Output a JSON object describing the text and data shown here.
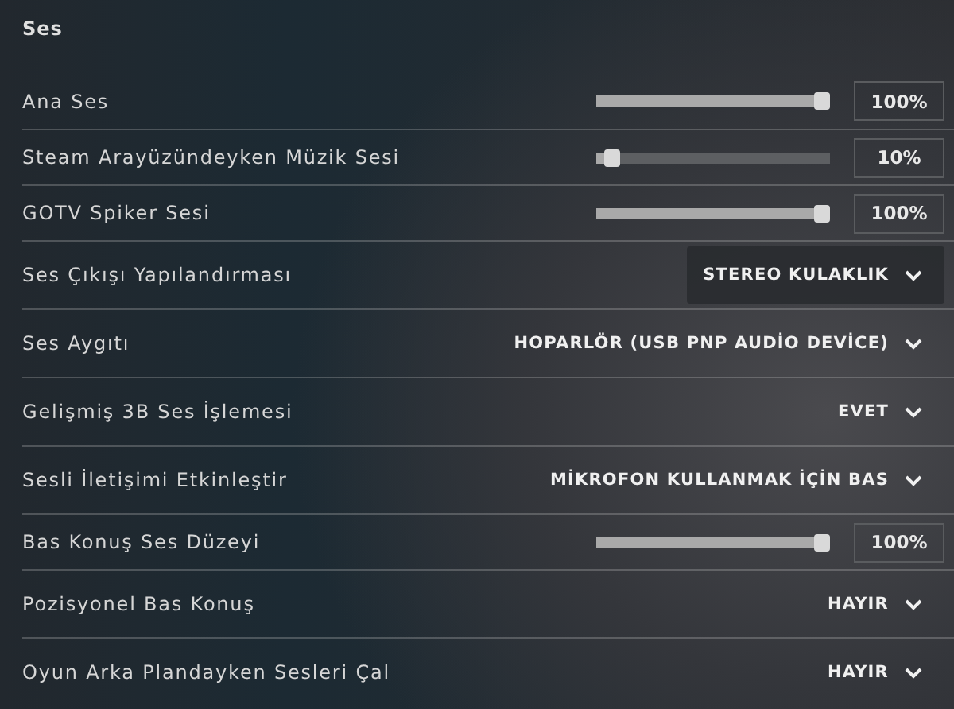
{
  "section_title": "Ses",
  "rows": [
    {
      "kind": "slider",
      "label": "Ana Ses",
      "level": 1.0,
      "reading": "100%"
    },
    {
      "kind": "slider",
      "label": "Steam Arayüzündeyken Müzik Sesi",
      "level": 0.1,
      "reading": "10%"
    },
    {
      "kind": "slider",
      "label": "GOTV Spiker Sesi",
      "level": 1.0,
      "reading": "100%"
    },
    {
      "kind": "dropdown",
      "label": "Ses Çıkışı Yapılandırması",
      "value": "STEREO KULAKLIK",
      "highlighted": true
    },
    {
      "kind": "dropdown",
      "label": "Ses Aygıtı",
      "value": "HOPARLÖR (USB PNP AUDİO DEVİCE)",
      "highlighted": false
    },
    {
      "kind": "dropdown",
      "label": "Gelişmiş 3B Ses İşlemesi",
      "value": "EVET",
      "highlighted": false
    },
    {
      "kind": "dropdown",
      "label": "Sesli İletişimi Etkinleştir",
      "value": "MİKROFON KULLANMAK İÇİN BAS",
      "highlighted": false
    },
    {
      "kind": "slider",
      "label": "Bas Konuş Ses Düzeyi",
      "level": 1.0,
      "reading": "100%"
    },
    {
      "kind": "dropdown",
      "label": "Pozisyonel Bas Konuş",
      "value": "HAYIR",
      "highlighted": false
    },
    {
      "kind": "dropdown",
      "label": "Oyun Arka Plandayken Sesleri Çal",
      "value": "HAYIR",
      "highlighted": false
    }
  ]
}
